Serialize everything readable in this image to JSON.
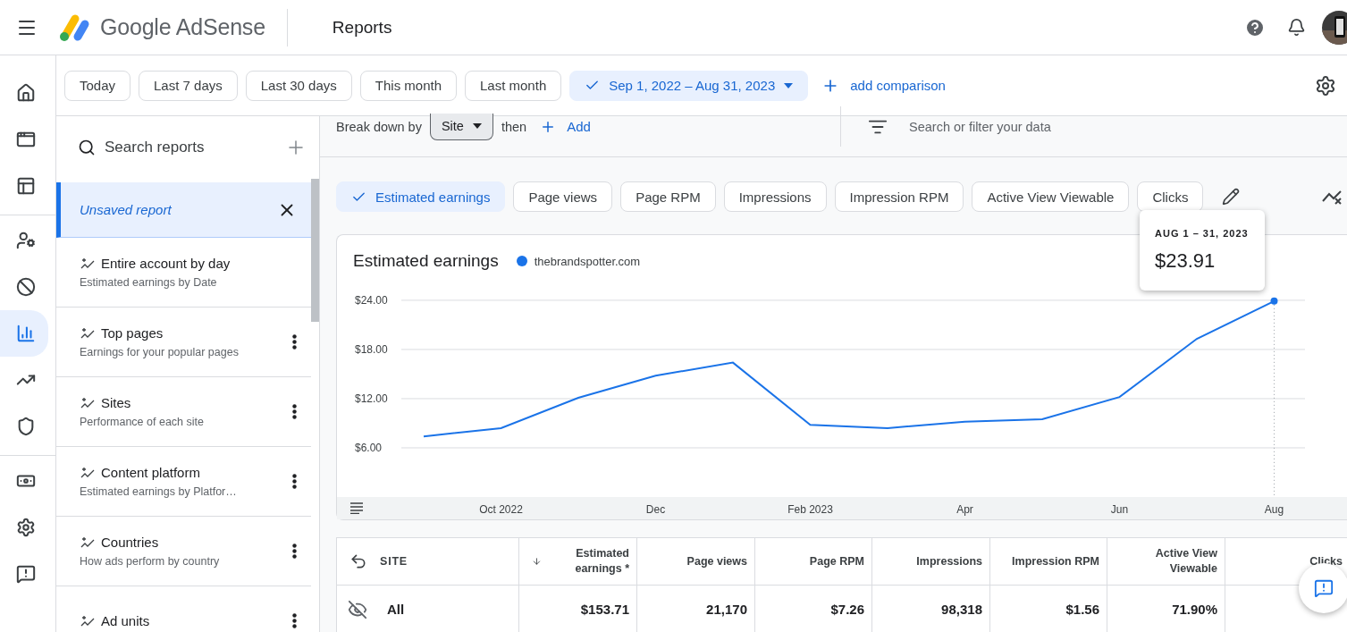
{
  "header": {
    "app_name": "Google AdSense",
    "page_title": "Reports"
  },
  "nav_groups": [
    {
      "items": [
        {
          "kind": "home",
          "selected": false
        },
        {
          "kind": "ads",
          "selected": false
        },
        {
          "kind": "layout",
          "selected": false
        }
      ]
    },
    {
      "items": [
        {
          "kind": "account",
          "selected": false
        },
        {
          "kind": "block",
          "selected": false
        },
        {
          "kind": "reports",
          "selected": true
        },
        {
          "kind": "optimize",
          "selected": false
        },
        {
          "kind": "privacy",
          "selected": false
        }
      ]
    },
    {
      "items": [
        {
          "kind": "payments",
          "selected": false
        },
        {
          "kind": "settings",
          "selected": false
        },
        {
          "kind": "feedback",
          "selected": false
        }
      ]
    }
  ],
  "date_presets": [
    {
      "label": "Today",
      "selected": false
    },
    {
      "label": "Last 7 days",
      "selected": false
    },
    {
      "label": "Last 30 days",
      "selected": false
    },
    {
      "label": "This month",
      "selected": false
    },
    {
      "label": "Last month",
      "selected": false
    },
    {
      "label": "Sep 1, 2022 – Aug 31, 2023",
      "selected": true
    }
  ],
  "add_comparison": "add comparison",
  "reports_panel": {
    "search_placeholder": "Search reports",
    "current": "Unsaved report",
    "items": [
      {
        "title": "Entire account by day",
        "subtitle": "Estimated earnings by Date",
        "has_menu": false
      },
      {
        "title": "Top pages",
        "subtitle": "Earnings for your popular pages",
        "has_menu": true
      },
      {
        "title": "Sites",
        "subtitle": "Performance of each site",
        "has_menu": true
      },
      {
        "title": "Content platform",
        "subtitle": "Estimated earnings by Platfor…",
        "has_menu": true
      },
      {
        "title": "Countries",
        "subtitle": "How ads perform by country",
        "has_menu": true
      },
      {
        "title": "Ad units",
        "has_menu": true
      }
    ]
  },
  "breakdown": {
    "label": "Break down by",
    "value": "Site",
    "then": "then",
    "add": "Add"
  },
  "filter": {
    "placeholder": "Search or filter your data"
  },
  "metrics": [
    {
      "label": "Estimated earnings",
      "selected": true
    },
    {
      "label": "Page views",
      "selected": false
    },
    {
      "label": "Page RPM",
      "selected": false
    },
    {
      "label": "Impressions",
      "selected": false
    },
    {
      "label": "Impression RPM",
      "selected": false
    },
    {
      "label": "Active View Viewable",
      "selected": false
    },
    {
      "label": "Clicks",
      "selected": false
    }
  ],
  "chart": {
    "title": "Estimated earnings",
    "tooltip": {
      "date": "AUG 1 – 31, 2023",
      "value": "$23.91"
    },
    "chart_data": {
      "type": "line",
      "categories": [
        null,
        "Oct 2022",
        null,
        "Dec",
        null,
        "Feb 2023",
        null,
        "Apr",
        null,
        "Jun",
        null,
        "Aug"
      ],
      "series": [
        {
          "name": "thebrandspotter.com",
          "color": "#1a73e8",
          "values": [
            7.4,
            8.4,
            12.1,
            14.8,
            16.4,
            8.8,
            8.4,
            9.2,
            9.5,
            12.2,
            19.3,
            23.9
          ]
        }
      ],
      "ylim": [
        0,
        24
      ],
      "grid": true,
      "yticks": [
        {
          "value": 6,
          "label": "$6.00"
        },
        {
          "value": 12,
          "label": "$12.00"
        },
        {
          "value": 18,
          "label": "$18.00"
        },
        {
          "value": 24,
          "label": "$24.00"
        }
      ]
    }
  },
  "table": {
    "columns": [
      {
        "label": "SITE",
        "sorted": false
      },
      {
        "label": "Estimated earnings *",
        "sorted": true
      },
      {
        "label": "Page views",
        "sorted": false
      },
      {
        "label": "Page RPM",
        "sorted": false
      },
      {
        "label": "Impressions",
        "sorted": false
      },
      {
        "label": "Impression RPM",
        "sorted": false
      },
      {
        "label": "Active View Viewable",
        "sorted": false
      },
      {
        "label": "Clicks",
        "sorted": false
      }
    ],
    "rows": [
      {
        "cells": [
          "All",
          "$153.71",
          "21,170",
          "$7.26",
          "98,318",
          "$1.56",
          "71.90%"
        ]
      }
    ]
  }
}
